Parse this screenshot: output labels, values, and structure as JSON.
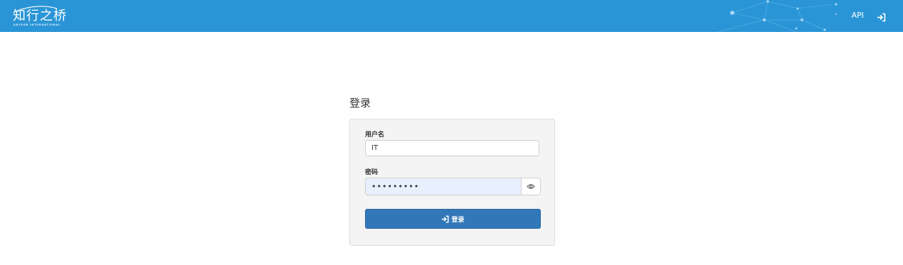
{
  "navbar": {
    "logo_text": "知行之桥",
    "logo_subtitle": "ARCESB INTERNATIONAL",
    "api_label": "API",
    "login_icon": "sign-in-icon",
    "background_color": "#2a95d6"
  },
  "page": {
    "title": "登录"
  },
  "form": {
    "username_label": "用户名",
    "username_value": "IT",
    "password_label": "密码",
    "password_value": "•••••••••",
    "password_toggle_icon": "eye-icon",
    "submit_label": "登录",
    "submit_icon": "sign-in-icon",
    "submit_color": "#3278b8"
  }
}
